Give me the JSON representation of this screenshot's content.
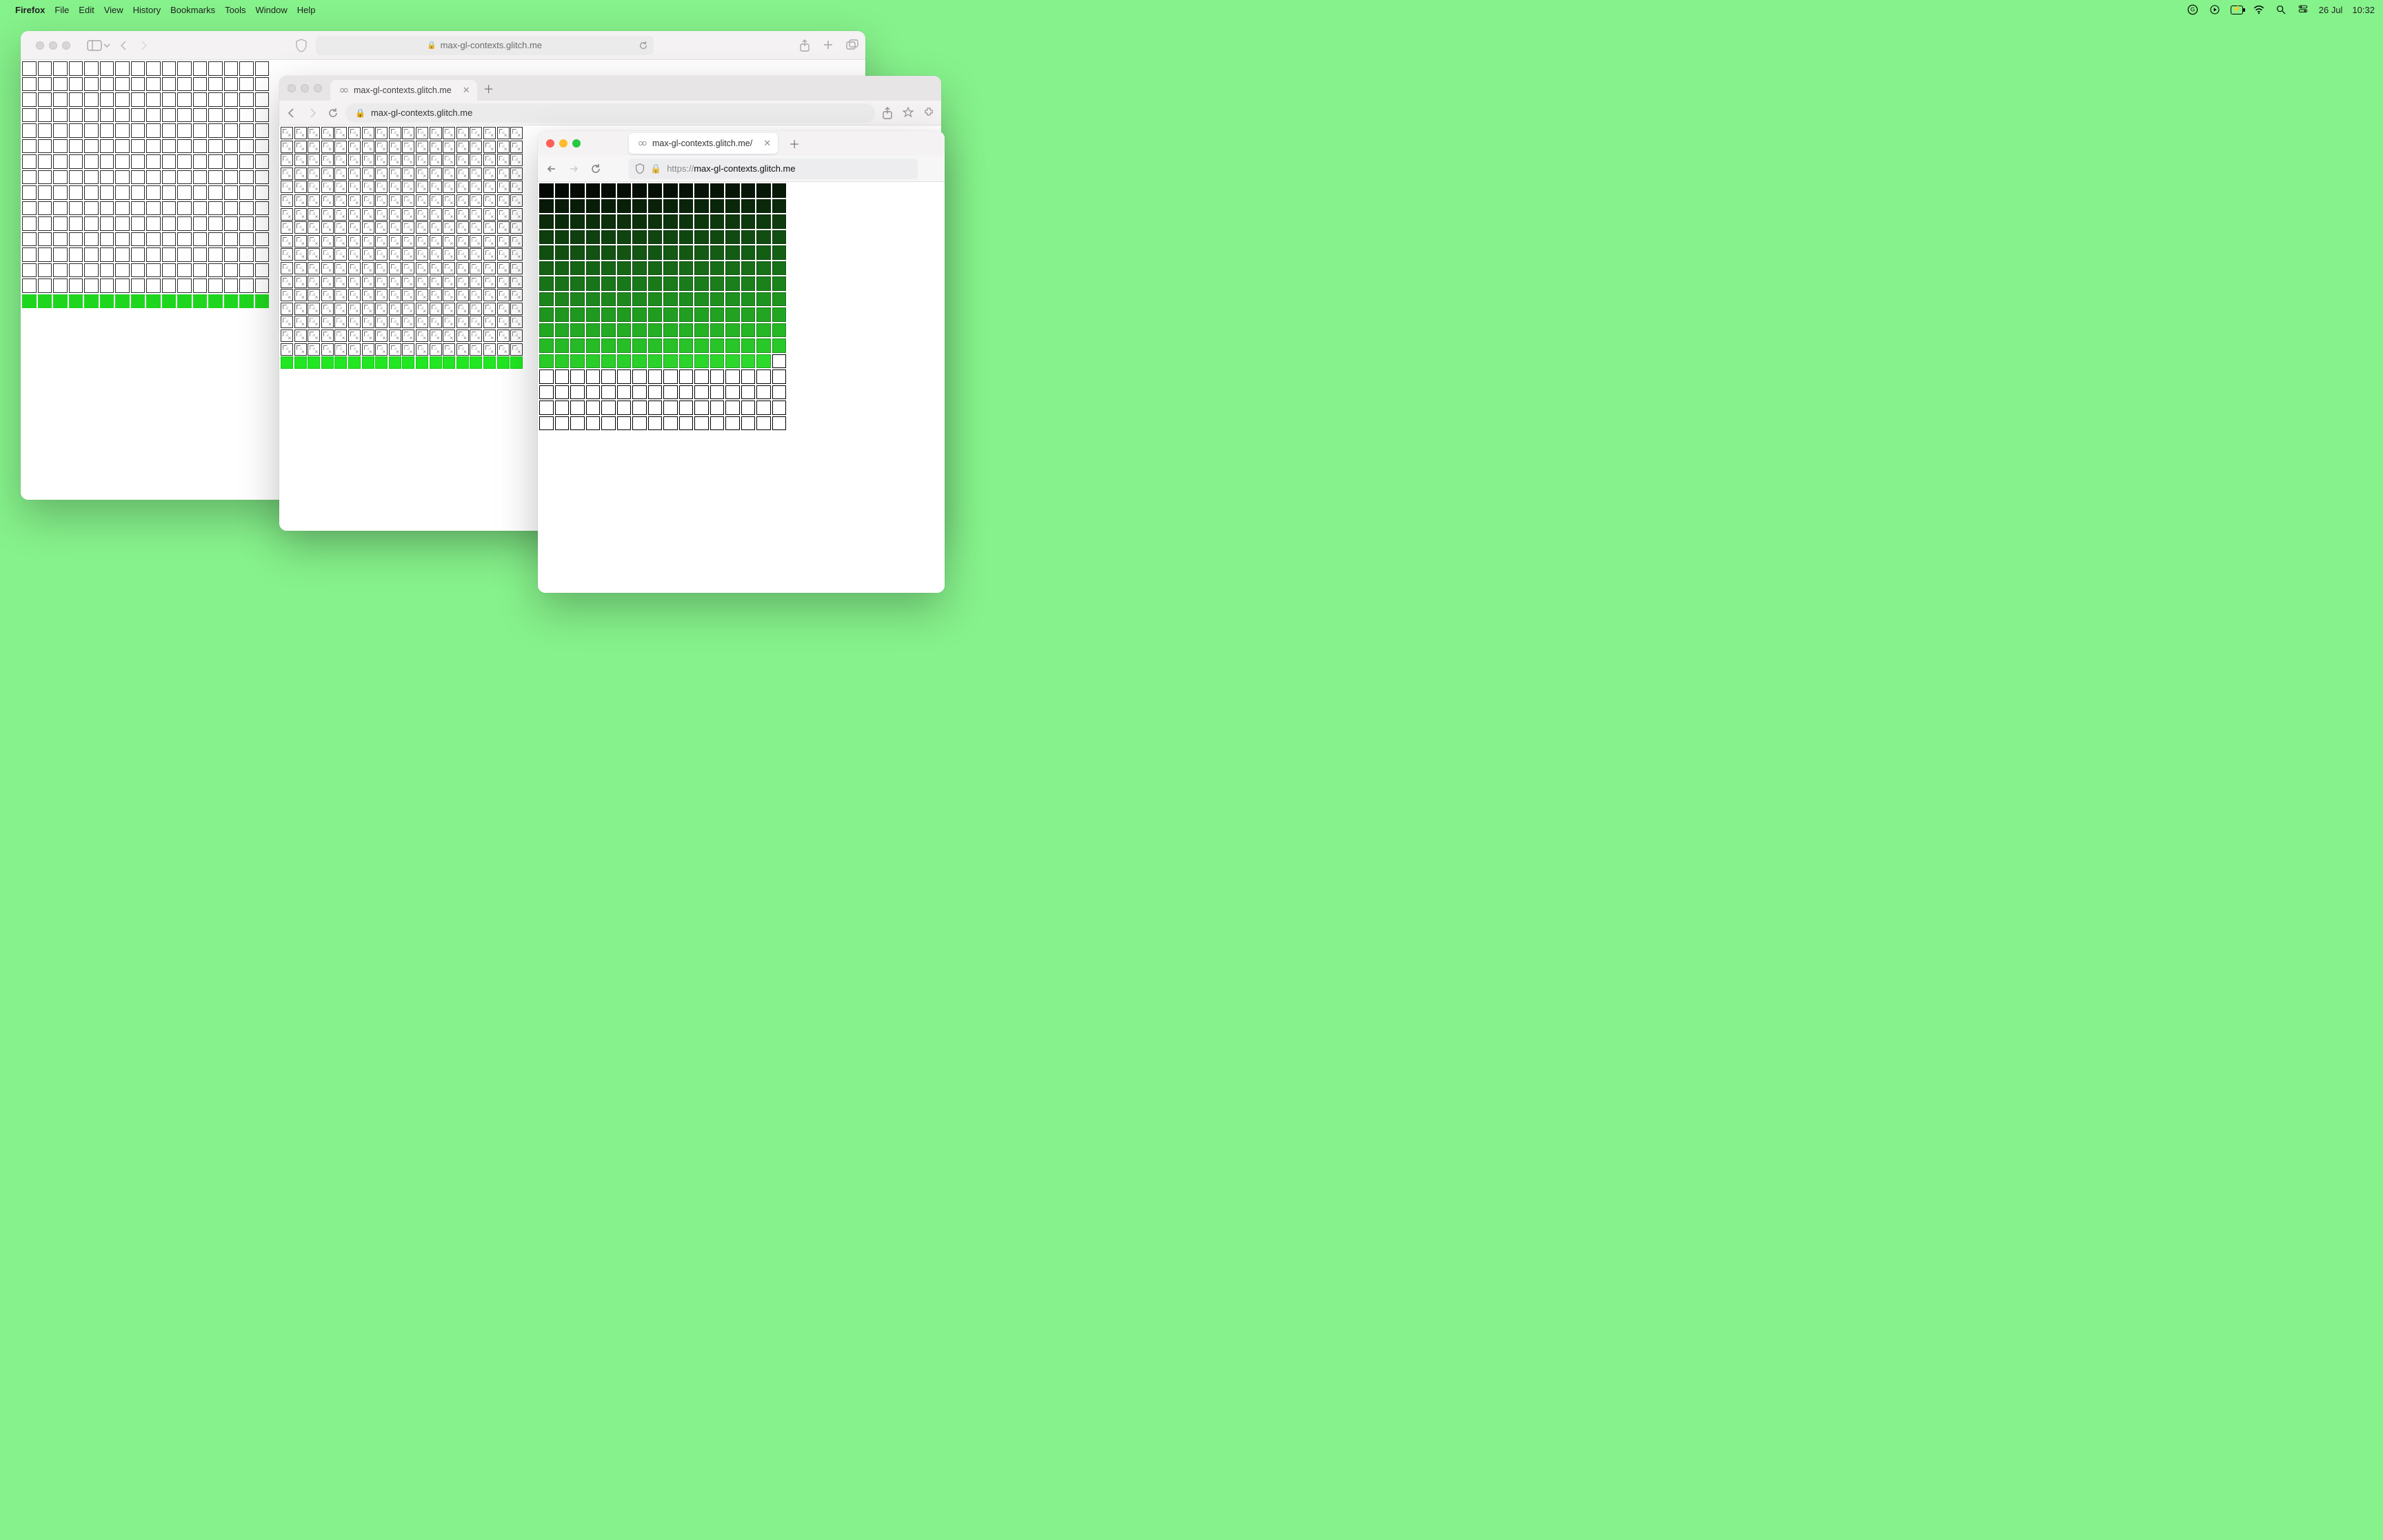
{
  "menubar": {
    "app": "Firefox",
    "items": [
      "File",
      "Edit",
      "View",
      "History",
      "Bookmarks",
      "Tools",
      "Window",
      "Help"
    ],
    "date": "26 Jul",
    "time": "10:32"
  },
  "safari": {
    "url_display": "max-gl-contexts.glitch.me",
    "grid": {
      "cols": 16,
      "rows": 16,
      "green_last_row": true
    }
  },
  "chromium": {
    "tab_title": "max-gl-contexts.glitch.me",
    "url_display": "max-gl-contexts.glitch.me",
    "grid": {
      "cols": 18,
      "rows": 18,
      "green_last_row": true
    }
  },
  "firefox_win": {
    "tab_title": "max-gl-contexts.glitch.me/",
    "url_prefix": "https://",
    "url_host": "max-gl-contexts.glitch.me",
    "grid": {
      "cols": 16,
      "rows": 16,
      "filled_count": 191
    }
  },
  "icons": {
    "apple": "apple-logo",
    "g": "grammarly-icon",
    "play": "play-circle-icon",
    "battery": "battery-charging-icon",
    "wifi": "wifi-icon",
    "search": "spotlight-icon",
    "cc": "control-center-icon"
  }
}
